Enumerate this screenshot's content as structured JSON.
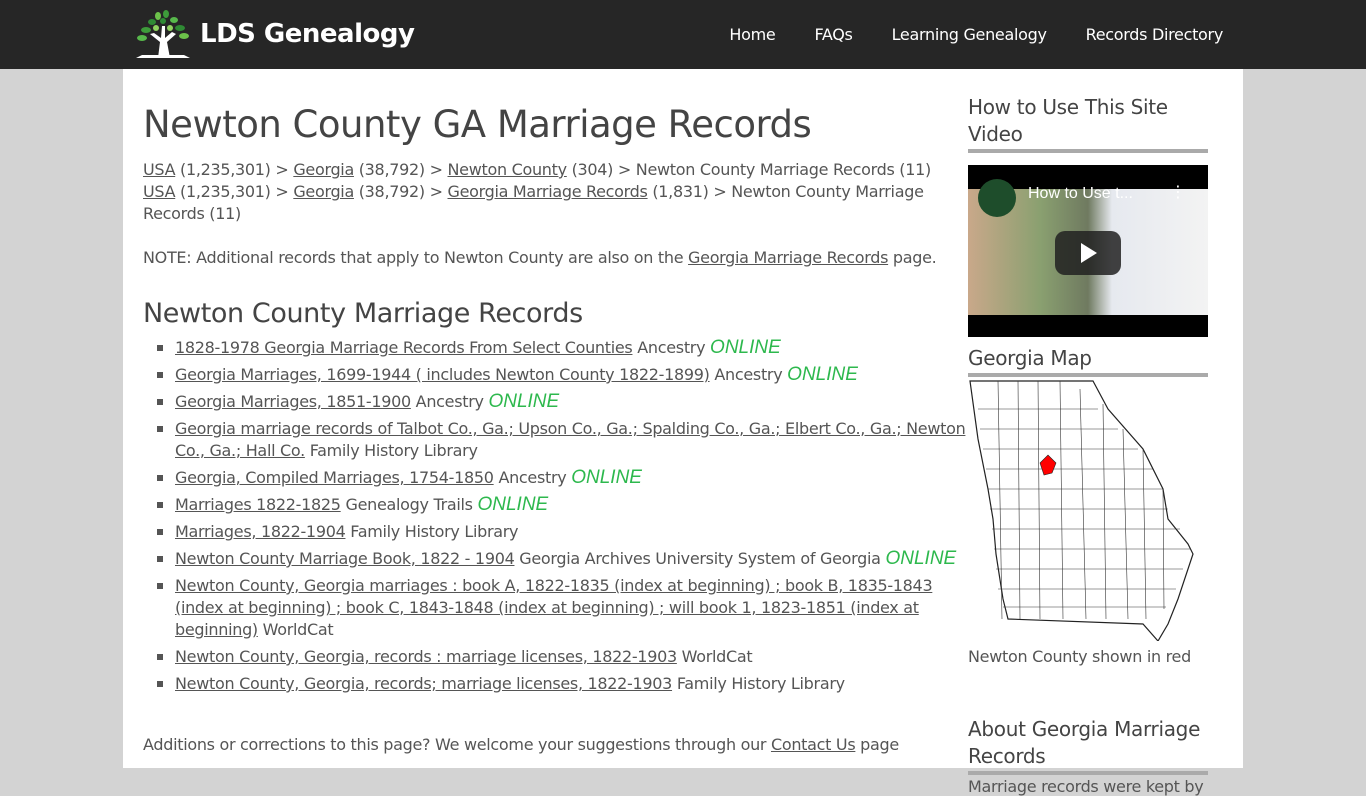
{
  "header": {
    "logo_text": "LDS Genealogy",
    "nav": [
      {
        "label": "Home"
      },
      {
        "label": "FAQs"
      },
      {
        "label": "Learning Genealogy"
      },
      {
        "label": "Records Directory"
      }
    ]
  },
  "main": {
    "title": "Newton County GA Marriage Records",
    "breadcrumbs": [
      {
        "parts": [
          {
            "link": "USA",
            "count": " (1,235,301) > "
          },
          {
            "link": "Georgia",
            "count": " (38,792) > "
          },
          {
            "link": "Newton County",
            "count": " (304) > "
          },
          {
            "text": "Newton County Marriage Records (11)"
          }
        ]
      },
      {
        "parts": [
          {
            "link": "USA",
            "count": " (1,235,301) > "
          },
          {
            "link": "Georgia",
            "count": " (38,792) > "
          },
          {
            "link": "Georgia Marriage Records",
            "count": " (1,831) > "
          },
          {
            "text": "Newton County Marriage Records (11)"
          }
        ]
      }
    ],
    "note_prefix": "NOTE: Additional records that apply to Newton County are also on the ",
    "note_link": "Georgia Marriage Records",
    "note_suffix": " page.",
    "section_title": "Newton County Marriage Records",
    "online_label": "ONLINE",
    "records": [
      {
        "title": "1828-1978 Georgia Marriage Records From Select Counties",
        "source": "Ancestry",
        "online": true
      },
      {
        "title": "Georgia Marriages, 1699-1944 ( includes Newton County 1822-1899)",
        "source": "Ancestry",
        "online": true
      },
      {
        "title": "Georgia Marriages, 1851-1900",
        "source": "Ancestry",
        "online": true
      },
      {
        "title": "Georgia marriage records of Talbot Co., Ga.; Upson Co., Ga.; Spalding Co., Ga.; Elbert Co., Ga.; Newton Co., Ga.; Hall Co.",
        "source": "Family History Library",
        "online": false
      },
      {
        "title": "Georgia, Compiled Marriages, 1754-1850",
        "source": "Ancestry",
        "online": true
      },
      {
        "title": "Marriages 1822-1825",
        "source": "Genealogy Trails",
        "online": true
      },
      {
        "title": "Marriages, 1822-1904",
        "source": "Family History Library",
        "online": false
      },
      {
        "title": "Newton County Marriage Book, 1822 - 1904",
        "source": "Georgia Archives University System of Georgia",
        "online": true
      },
      {
        "title": "Newton County, Georgia marriages : book A, 1822-1835 (index at beginning) ; book B, 1835-1843 (index at beginning) ; book C, 1843-1848 (index at beginning) ; will book 1, 1823-1851 (index at beginning)",
        "source": "WorldCat",
        "online": false
      },
      {
        "title": "Newton County, Georgia, records : marriage licenses, 1822-1903",
        "source": "WorldCat",
        "online": false
      },
      {
        "title": "Newton County, Georgia, records; marriage licenses, 1822-1903",
        "source": "Family History Library",
        "online": false
      }
    ],
    "footer_prefix": "Additions or corrections to this page? We welcome your suggestions through our ",
    "footer_link": "Contact Us",
    "footer_suffix": " page"
  },
  "sidebar": {
    "video_heading": "How to Use This Site Video",
    "video_title": "How to Use t...",
    "map_heading": "Georgia Map",
    "map_caption": "Newton County shown in red",
    "about_heading": "About Georgia Marriage Records",
    "about_text": "Marriage records were kept by"
  },
  "colors": {
    "header_bg": "#262626",
    "online_green": "#2db84d",
    "highlight_county": "#ff0000",
    "page_bg": "#d3d3d3"
  }
}
